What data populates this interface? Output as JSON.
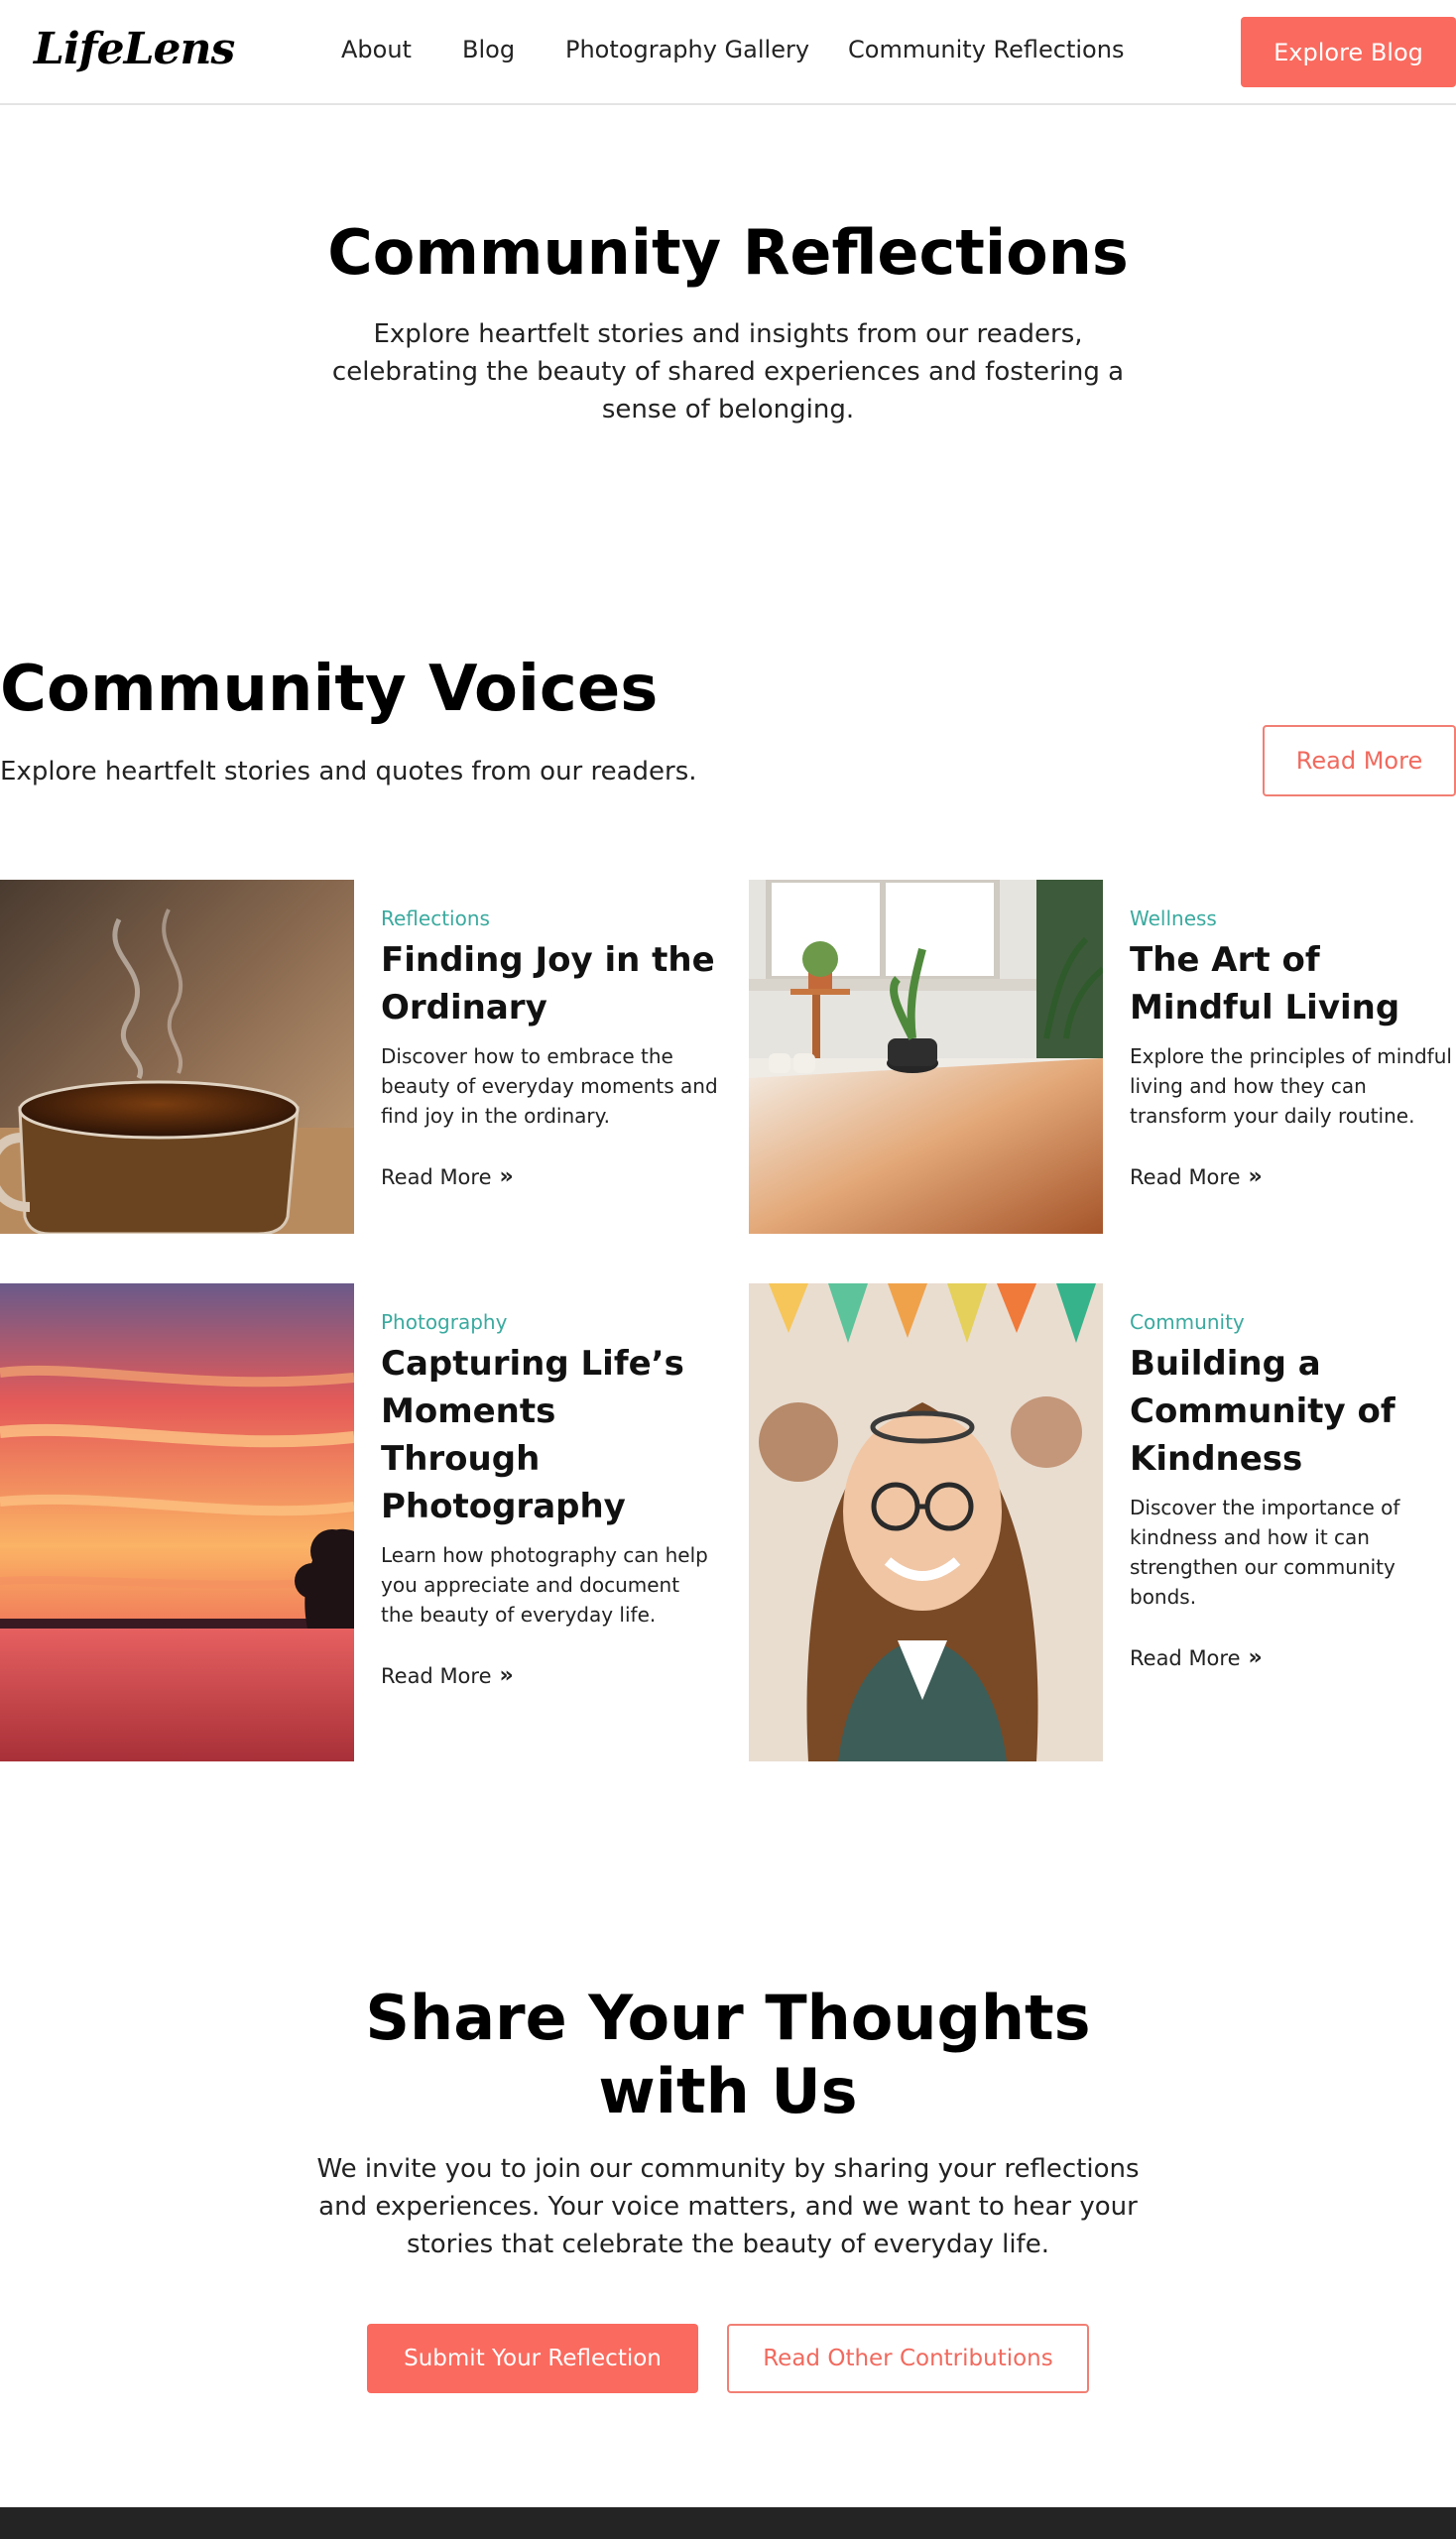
{
  "header": {
    "logo": "LifeLens",
    "nav": [
      "About",
      "Blog",
      "Photography Gallery",
      "Community Reflections"
    ],
    "cta": "Explore Blog"
  },
  "hero": {
    "title": "Community Reflections",
    "subtitle": "Explore heartfelt stories and insights from our readers, celebrating the beauty of shared experiences and fostering a sense of belonging."
  },
  "voices": {
    "title": "Community Voices",
    "subtitle": "Explore heartfelt stories and quotes from our readers.",
    "read_more": "Read More",
    "cards": [
      {
        "category": "Reflections",
        "title": "Finding Joy in the Ordinary",
        "description": "Discover how to embrace the beauty of everyday moments and find joy in the ordinary.",
        "link": "Read More",
        "image": "coffee-cup-steam"
      },
      {
        "category": "Wellness",
        "title": "The Art of Mindful Living",
        "description": "Explore the principles of mindful living and how they can transform your daily routine.",
        "link": "Read More",
        "image": "sunlit-room-plants"
      },
      {
        "category": "Photography",
        "title": "Capturing Life’s Moments Through Photography",
        "description": "Learn how photography can help you appreciate and document the beauty of everyday life.",
        "link": "Read More",
        "image": "sunset-over-lake"
      },
      {
        "category": "Community",
        "title": "Building a Community of Kindness",
        "description": "Discover the importance of kindness and how it can strengthen our community bonds.",
        "link": "Read More",
        "image": "smiling-woman-crowd"
      }
    ]
  },
  "share": {
    "title": "Share Your Thoughts with Us",
    "subtitle": "We invite you to join our community by sharing your reflections and experiences. Your voice matters, and we want to hear your stories that celebrate the beauty of everyday life.",
    "submit": "Submit Your Reflection",
    "other": "Read Other Contributions"
  },
  "colors": {
    "accent": "#fa6a5e",
    "category": "#3aaa9f",
    "footer": "#242424"
  }
}
